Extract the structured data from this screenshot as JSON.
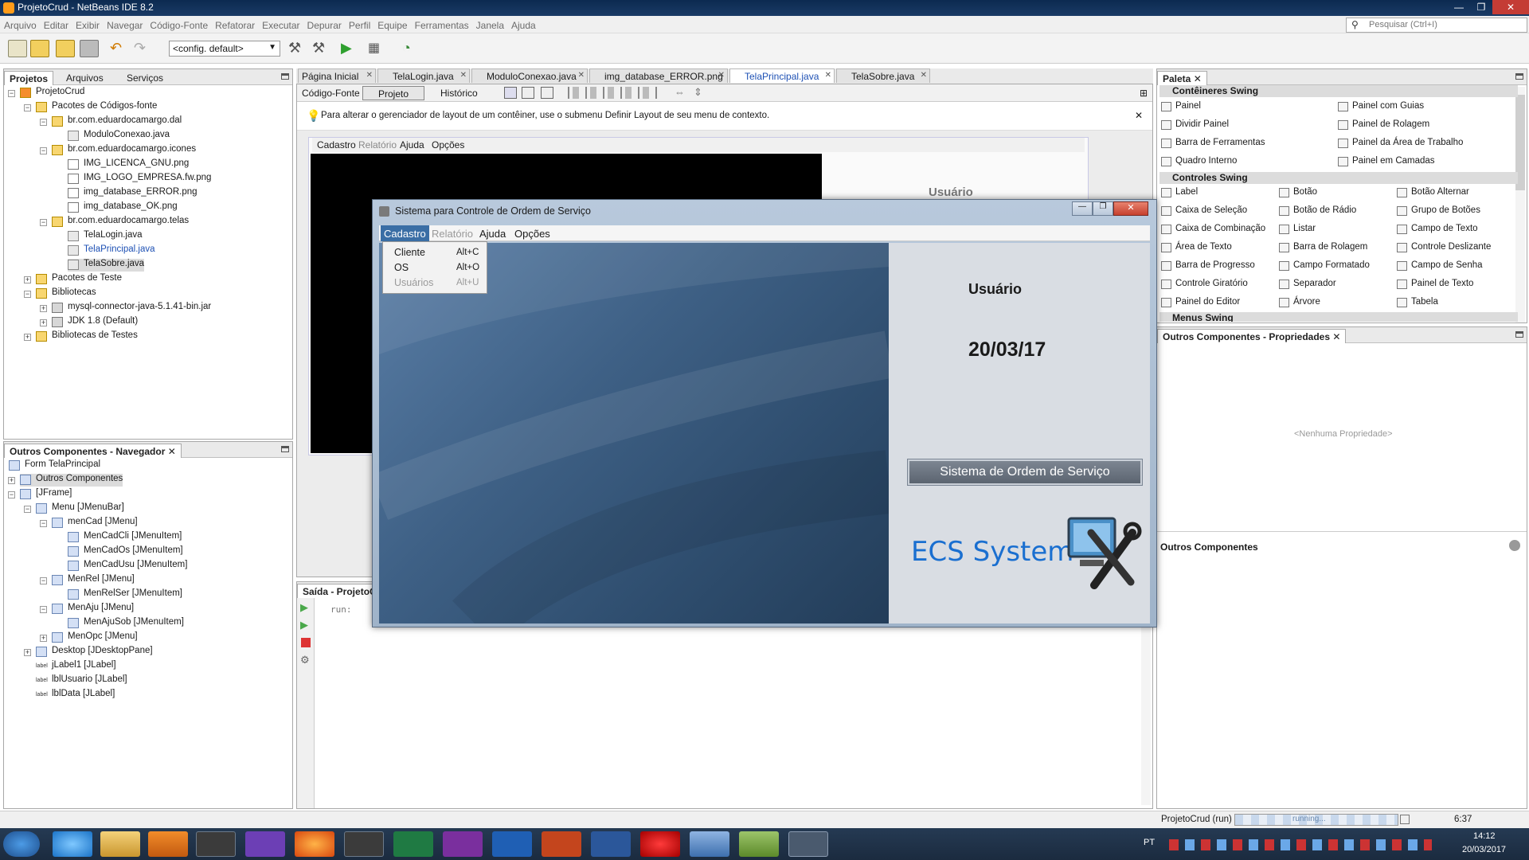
{
  "window": {
    "title": "ProjetoCrud - NetBeans IDE 8.2"
  },
  "menubar": [
    "Arquivo",
    "Editar",
    "Exibir",
    "Navegar",
    "Código-Fonte",
    "Refatorar",
    "Executar",
    "Depurar",
    "Perfil",
    "Equipe",
    "Ferramentas",
    "Janela",
    "Ajuda"
  ],
  "search": {
    "placeholder": "Pesquisar (Ctrl+I)"
  },
  "toolbar": {
    "config": "<config. default>"
  },
  "projects": {
    "tabs": [
      "Projetos",
      "Arquivos",
      "Serviços"
    ],
    "tree": [
      "ProjetoCrud",
      "Pacotes de Códigos-fonte",
      "br.com.eduardocamargo.dal",
      "ModuloConexao.java",
      "br.com.eduardocamargo.icones",
      "IMG_LICENCA_GNU.png",
      "IMG_LOGO_EMPRESA.fw.png",
      "img_database_ERROR.png",
      "img_database_OK.png",
      "br.com.eduardocamargo.telas",
      "TelaLogin.java",
      "TelaPrincipal.java",
      "TelaSobre.java",
      "Pacotes de Teste",
      "Bibliotecas",
      "mysql-connector-java-5.1.41-bin.jar",
      "JDK 1.8 (Default)",
      "Bibliotecas de Testes"
    ]
  },
  "navigator": {
    "title": "Outros Componentes - Navegador",
    "tree": [
      "Form TelaPrincipal",
      "Outros Componentes",
      "[JFrame]",
      "Menu [JMenuBar]",
      "menCad [JMenu]",
      "MenCadCli [JMenuItem]",
      "MenCadOs [JMenuItem]",
      "MenCadUsu [JMenuItem]",
      "MenRel [JMenu]",
      "MenRelSer [JMenuItem]",
      "MenAju [JMenu]",
      "MenAjuSob [JMenuItem]",
      "MenOpc [JMenu]",
      "Desktop [JDesktopPane]",
      "jLabel1 [JLabel]",
      "lblUsuario [JLabel]",
      "lblData [JLabel]"
    ]
  },
  "editor": {
    "tabs": [
      "Página Inicial",
      "TelaLogin.java",
      "ModuloConexao.java",
      "img_database_ERROR.png",
      "TelaPrincipal.java",
      "TelaSobre.java"
    ],
    "modes": [
      "Código-Fonte",
      "Projeto",
      "Histórico"
    ],
    "hint": "Para alterar o gerenciador de layout de um contêiner, use o submenu Definir Layout de seu menu de contexto.",
    "designer_menu": [
      "Cadastro",
      "Relatório",
      "Ajuda",
      "Opções"
    ],
    "designer_usuario": "Usuário"
  },
  "output": {
    "title": "Saída - ProjetoCr",
    "text": "run:"
  },
  "palette": {
    "title": "Paleta",
    "sections": [
      "Contêineres Swing",
      "Controles Swing",
      "Menus Swing"
    ],
    "containers": [
      "Painel",
      "Painel com Guias",
      "Dividir Painel",
      "Painel de Rolagem",
      "Barra de Ferramentas",
      "Painel da Área de Trabalho",
      "Quadro Interno",
      "Painel em Camadas"
    ],
    "controls": [
      "Label",
      "Botão",
      "Botão Alternar",
      "Caixa de Seleção",
      "Botão de Rádio",
      "Grupo de Botões",
      "Caixa de Combinação",
      "Listar",
      "Campo de Texto",
      "Área de Texto",
      "Barra de Rolagem",
      "Controle Deslizante",
      "Barra de Progresso",
      "Campo Formatado",
      "Campo de Senha",
      "Controle Giratório",
      "Separador",
      "Painel de Texto",
      "Painel do Editor",
      "Árvore",
      "Tabela"
    ]
  },
  "properties": {
    "title": "Outros Componentes - Propriedades",
    "empty": "<Nenhuma Propriedade>",
    "footer": "Outros Componentes"
  },
  "app": {
    "title": "Sistema para Controle de Ordem de Serviço",
    "menu": [
      "Cadastro",
      "Relatório",
      "Ajuda",
      "Opções"
    ],
    "dropdown": [
      {
        "label": "Cliente",
        "key": "Alt+C"
      },
      {
        "label": "OS",
        "key": "Alt+O"
      },
      {
        "label": "Usuários",
        "key": "Alt+U"
      }
    ],
    "usuario": "Usuário",
    "data": "20/03/17",
    "banner": "Sistema de Ordem de Serviço",
    "logo": "ECS System"
  },
  "status": {
    "project": "ProjetoCrud (run)",
    "progress": "running...",
    "time": "6:37"
  },
  "taskbar": {
    "lang": "PT",
    "clock": "14:12",
    "date": "20/03/2017"
  }
}
